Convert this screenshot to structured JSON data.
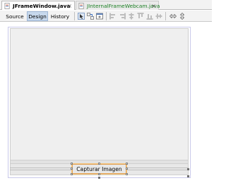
{
  "editor_tabs": [
    {
      "label": "JFrameWindow.java",
      "active": true,
      "close": "×"
    },
    {
      "label": "JInternalFrameWebcam.java",
      "active": false,
      "close": "×"
    }
  ],
  "view_buttons": {
    "source": "Source",
    "design": "Design",
    "history": "History",
    "selected": "Design"
  },
  "toolbar_icons": [
    "selection-mode-icon",
    "connection-mode-icon",
    "preview-design-icon",
    "align-left-icon",
    "align-right-icon",
    "center-horizontally-icon",
    "align-top-icon",
    "align-bottom-icon",
    "center-vertically-icon",
    "change-horizontal-resizability-icon",
    "change-vertical-resizability-icon"
  ],
  "form": {
    "button_label": "Capturar Imagen"
  },
  "colors": {
    "tab_active_bg": "#ffffff",
    "toolbar_bg": "#f3f3f3",
    "design_selected_bg": "#c7d8ec",
    "form_outline": "#c9c9ea",
    "canvas_bg": "#efefef",
    "selection_border": "#e0a25a"
  }
}
